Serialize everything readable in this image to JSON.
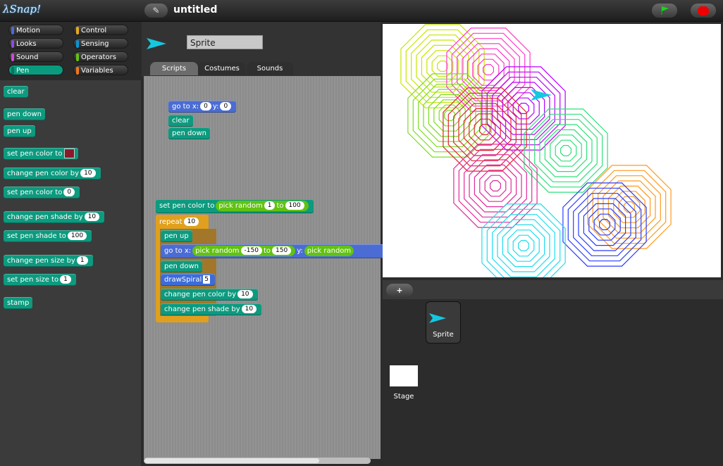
{
  "app": {
    "logo": "Snap!",
    "project_title": "untitled"
  },
  "categories": [
    {
      "label": "Motion",
      "color": "#4a6cd4"
    },
    {
      "label": "Control",
      "color": "#e6a822"
    },
    {
      "label": "Looks",
      "color": "#8f4ce0"
    },
    {
      "label": "Sensing",
      "color": "#0a94d6"
    },
    {
      "label": "Sound",
      "color": "#cf4ad9"
    },
    {
      "label": "Operators",
      "color": "#62c213"
    },
    {
      "label": "Pen",
      "color": "#0d9a7f"
    },
    {
      "label": "Variables",
      "color": "#f3761d"
    }
  ],
  "palette": {
    "clear": "clear",
    "pen_down": "pen down",
    "pen_up": "pen up",
    "set_pen_color_to": "set pen color to",
    "change_pen_color_by": "change pen color by",
    "change_pen_color_val": "10",
    "set_pen_color_to2": "set pen color to",
    "set_pen_color_val": "0",
    "change_pen_shade_by": "change pen shade by",
    "change_pen_shade_val": "10",
    "set_pen_shade_to": "set pen shade to",
    "set_pen_shade_val": "100",
    "change_pen_size_by": "change pen size by",
    "change_pen_size_val": "1",
    "set_pen_size_to": "set pen size to",
    "set_pen_size_val": "1",
    "stamp": "stamp"
  },
  "sprite": {
    "name": "Sprite"
  },
  "tabs": [
    "Scripts",
    "Costumes",
    "Sounds"
  ],
  "script1": {
    "goto": "go to x:",
    "x": "0",
    "y_label": "y:",
    "y": "0",
    "clear": "clear",
    "pen_down": "pen down"
  },
  "script2": {
    "set_pen_color_to": "set pen color to",
    "pick_random": "pick random",
    "pr_from": "1",
    "pr_to_label": "to",
    "pr_to": "100",
    "repeat": "repeat",
    "repeat_n": "10",
    "pen_up": "pen up",
    "goto": "go to x:",
    "goto_from": "-150",
    "goto_to_label": "to",
    "goto_to": "150",
    "y_label": "y:",
    "pick_random2": "pick random",
    "pen_down": "pen down",
    "draw_spiral": "drawSpiral",
    "spiral_n": "5",
    "change_pen_color_by": "change pen color by",
    "cpc_val": "10",
    "change_pen_shade_by": "change pen shade by",
    "cps_val": "10"
  },
  "corral": {
    "add": "+",
    "sprite_label": "Sprite",
    "stage_label": "Stage"
  }
}
